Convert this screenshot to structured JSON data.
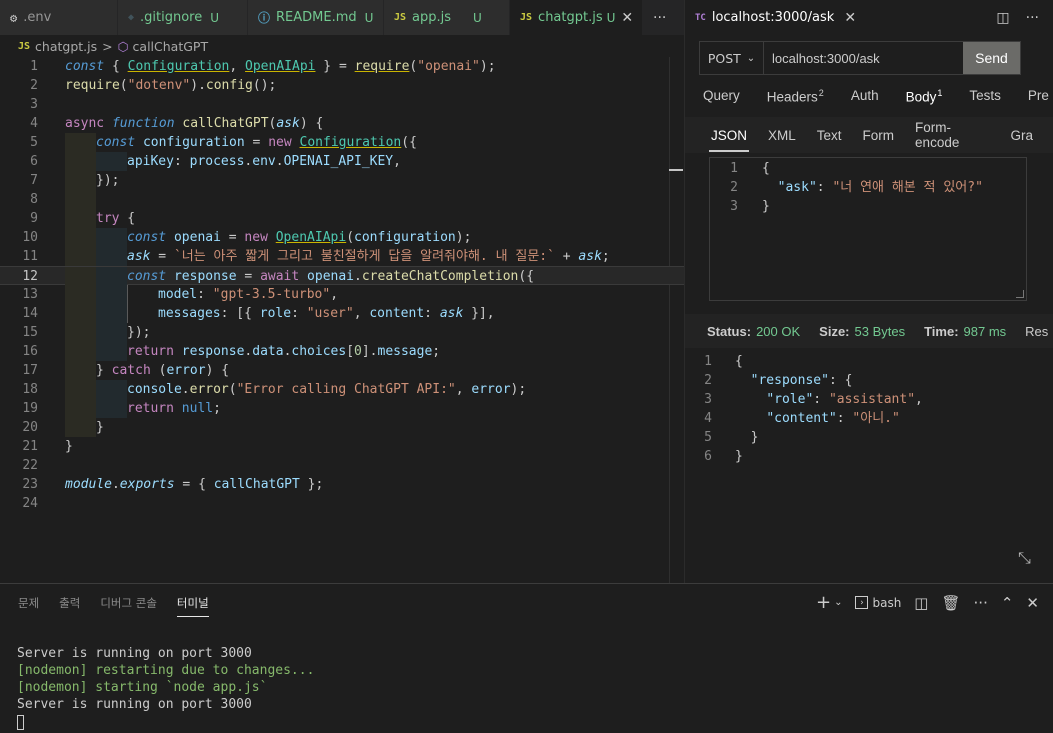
{
  "editor_tabs": [
    {
      "icon": "⚙",
      "label": ".env",
      "status": ""
    },
    {
      "icon": "◆",
      "label": ".gitignore",
      "status": "U"
    },
    {
      "icon": "ⓘ",
      "label": "README.md",
      "status": "U"
    },
    {
      "icon": "JS",
      "label": "app.js",
      "status": "U"
    },
    {
      "icon": "JS",
      "label": "chatgpt.js",
      "status": "U",
      "close": "✕"
    }
  ],
  "editor_more": "···",
  "rest_client_tab": {
    "icon": "TC",
    "label": "localhost:3000/ask",
    "close": "✕"
  },
  "breadcrumb": {
    "file_icon": "JS",
    "file": "chatgpt.js",
    "separator": ">",
    "symbol": "callChatGPT"
  },
  "line_numbers": [
    "1",
    "2",
    "3",
    "4",
    "5",
    "6",
    "7",
    "8",
    "9",
    "10",
    "11",
    "12",
    "13",
    "14",
    "15",
    "16",
    "17",
    "18",
    "19",
    "20",
    "21",
    "22",
    "23",
    "24"
  ],
  "current_line": 12,
  "request": {
    "method": "POST",
    "url": "localhost:3000/ask",
    "send": "Send",
    "tabs": [
      {
        "label": "Query",
        "count": ""
      },
      {
        "label": "Headers",
        "count": "2"
      },
      {
        "label": "Auth",
        "count": ""
      },
      {
        "label": "Body",
        "count": "1"
      },
      {
        "label": "Tests",
        "count": ""
      },
      {
        "label": "Pre",
        "count": ""
      }
    ],
    "active_tab": "Body",
    "body_tabs": [
      "JSON",
      "XML",
      "Text",
      "Form",
      "Form-encode",
      "Gra"
    ],
    "active_body_tab": "JSON",
    "body_line_numbers": [
      "1",
      "2",
      "3"
    ]
  },
  "response": {
    "status_label": "Status:",
    "status_value": "200 OK",
    "size_label": "Size:",
    "size_value": "53 Bytes",
    "time_label": "Time:",
    "time_value": "987 ms",
    "extra": "Res",
    "line_numbers": [
      "1",
      "2",
      "3",
      "4",
      "5",
      "6"
    ]
  },
  "panel": {
    "tabs": [
      "문제",
      "출력",
      "디버그 콘솔",
      "터미널"
    ],
    "active_tab": "터미널",
    "shell": "bash",
    "terminal_lines": [
      "Server is running on port 3000",
      "[nodemon] restarting due to changes...",
      "[nodemon] starting `node app.js`",
      "Server is running on port 3000"
    ]
  },
  "colors": {
    "keyword": "#569cd6",
    "control": "#c586c0",
    "function": "#dcdcaa",
    "string": "#ce9178",
    "variable": "#9cdcfe",
    "class": "#4ec9b0",
    "status_ok": "#73c991"
  }
}
